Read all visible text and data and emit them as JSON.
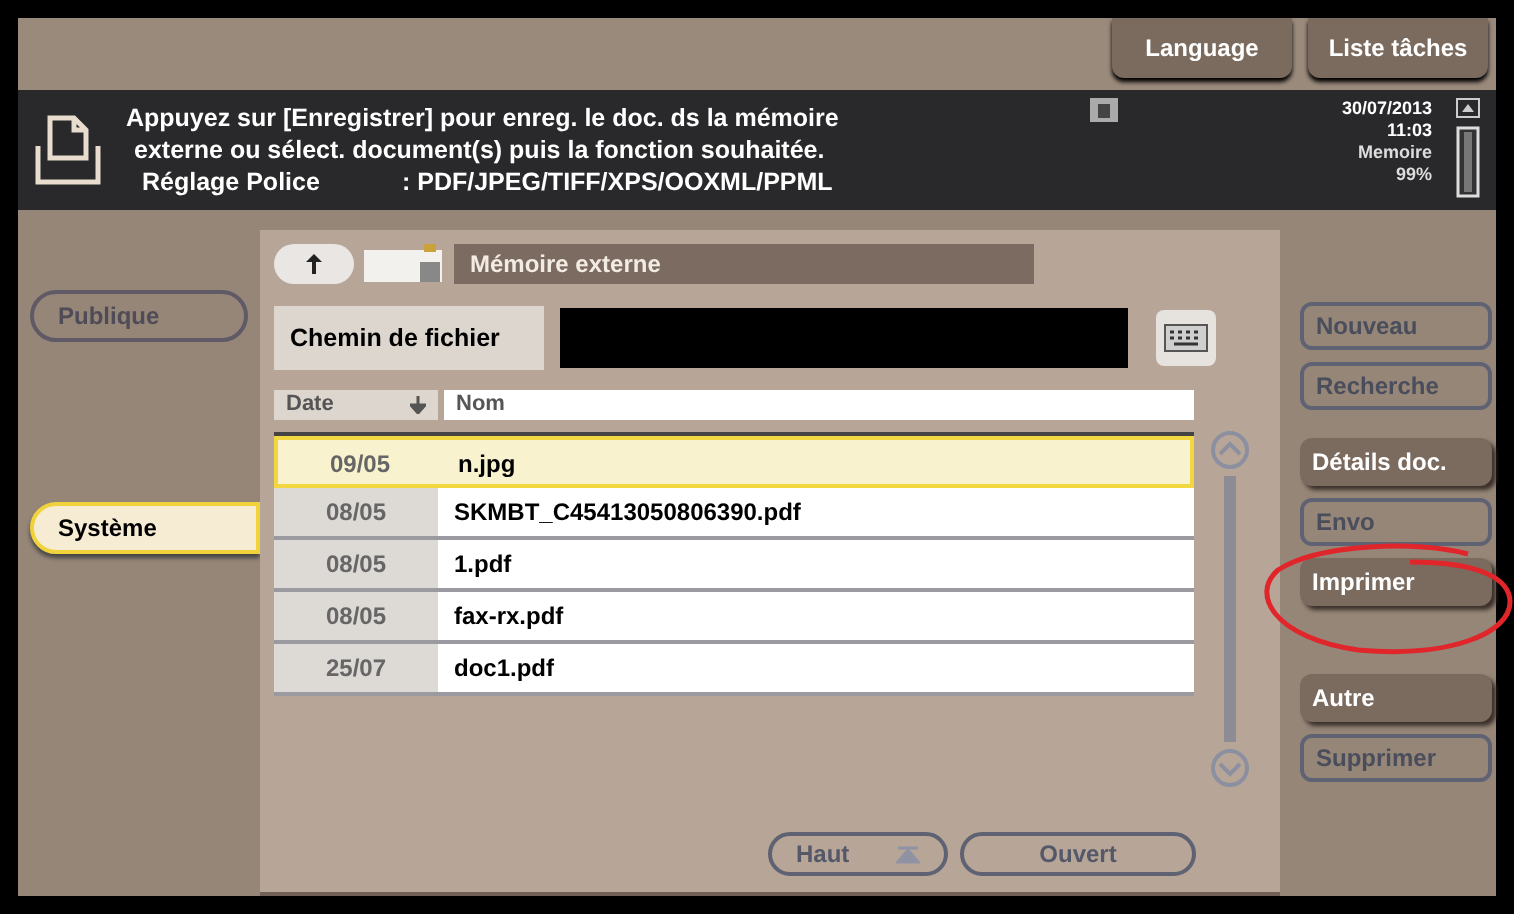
{
  "top_buttons": [
    {
      "label": "Language"
    },
    {
      "label": "Liste tâches"
    }
  ],
  "message": {
    "lines": [
      "Appuyez sur [Enregistrer] pour enreg. le doc. ds la mémoire",
      "externe ou sélect. document(s) puis la fonction souhaitée."
    ],
    "setting_label": "Réglage Police",
    "setting_value": ": PDF/JPEG/TIFF/XPS/OOXML/PPML"
  },
  "status": {
    "date": "30/07/2013",
    "time": "11:03",
    "memory_label": "Memoire",
    "memory_value": "99%"
  },
  "left_tabs": [
    {
      "label": "Publique",
      "selected": false,
      "disabled": true
    },
    {
      "label": "Système",
      "selected": true,
      "disabled": false
    }
  ],
  "location": {
    "title": "Mémoire externe"
  },
  "path": {
    "label": "Chemin de fichier"
  },
  "table": {
    "columns": [
      "Date",
      "Nom"
    ],
    "rows": [
      {
        "date": "09/05",
        "name": "n.jpg",
        "selected": true
      },
      {
        "date": "08/05",
        "name": "SKMBT_C45413050806390.pdf",
        "selected": false
      },
      {
        "date": "08/05",
        "name": "1.pdf",
        "selected": false
      },
      {
        "date": "08/05",
        "name": "fax-rx.pdf",
        "selected": false
      },
      {
        "date": "25/07",
        "name": "doc1.pdf",
        "selected": false
      }
    ]
  },
  "bottom_buttons": [
    {
      "label": "Haut",
      "disabled": true
    },
    {
      "label": "Ouvert",
      "disabled": true
    }
  ],
  "right_buttons": [
    {
      "label": "Nouveau",
      "disabled": true
    },
    {
      "label": "Recherche",
      "disabled": true
    },
    {
      "label": "Détails doc.",
      "disabled": false
    },
    {
      "label": "Envo",
      "disabled": true
    },
    {
      "label": "Imprimer",
      "disabled": false
    },
    {
      "label": "Autre",
      "disabled": false
    },
    {
      "label": "Supprimer",
      "disabled": true
    }
  ]
}
